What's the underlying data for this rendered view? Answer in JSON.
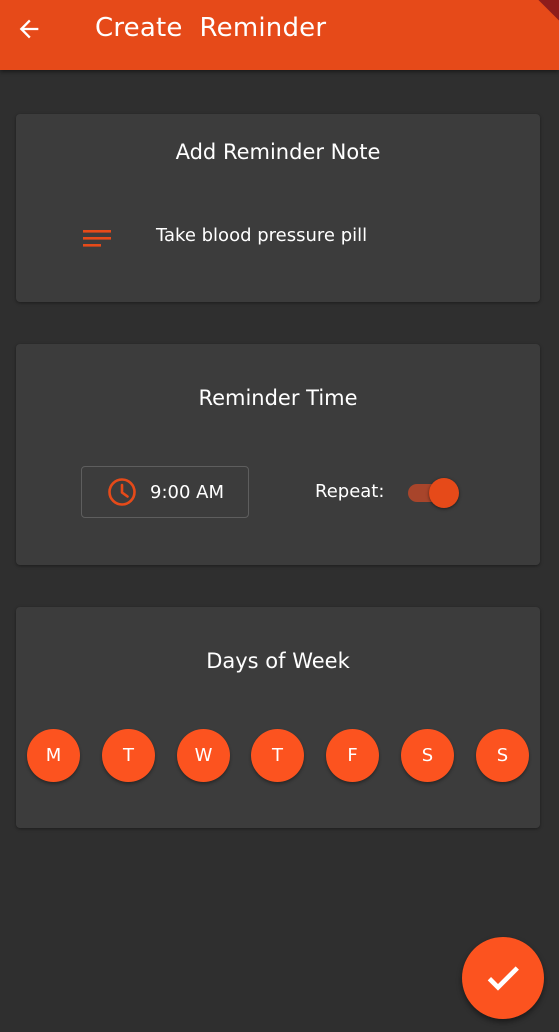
{
  "appbar": {
    "title": "Create  Reminder",
    "back_icon": "arrow-left-icon"
  },
  "note_card": {
    "title": "Add Reminder Note",
    "icon": "notes-icon",
    "note_text": "Take blood pressure pill"
  },
  "time_card": {
    "title": "Reminder Time",
    "clock_icon": "clock-icon",
    "time_value": "9:00 AM",
    "repeat_label": "Repeat:",
    "repeat_enabled": true
  },
  "days_card": {
    "title": "Days of Week",
    "days": [
      "M",
      "T",
      "W",
      "T",
      "F",
      "S",
      "S"
    ]
  },
  "fab": {
    "icon": "check-icon"
  },
  "colors": {
    "accent": "#e64a19",
    "day_button": "#fc531f",
    "background": "#2f2f2f",
    "card": "#3c3c3c"
  }
}
